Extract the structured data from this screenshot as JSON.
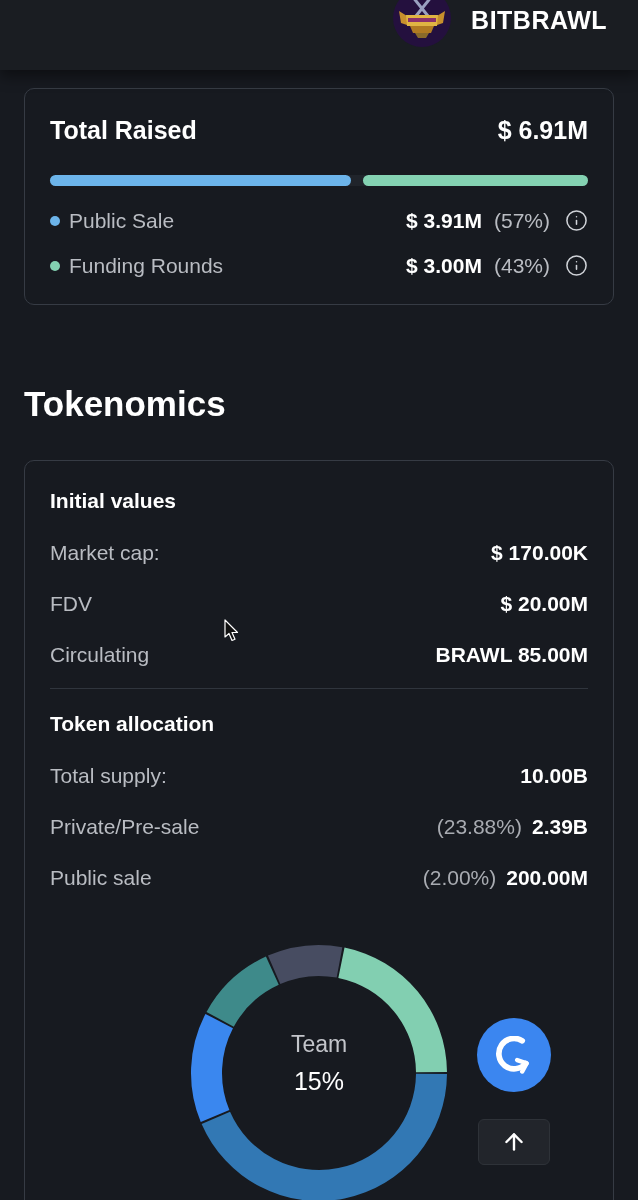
{
  "header": {
    "brand": "BITBRAWL"
  },
  "total_raised": {
    "title": "Total Raised",
    "value": "$ 6.91M",
    "segments": [
      {
        "label": "Public Sale",
        "amount": "$ 3.91M",
        "percent": "(57%)",
        "level": 0.57,
        "color": "#6cb4ea"
      },
      {
        "label": "Funding Rounds",
        "amount": "$ 3.00M",
        "percent": "(43%)",
        "level": 0.43,
        "color": "#84d2b2"
      }
    ]
  },
  "tokenomics": {
    "heading": "Tokenomics",
    "sections": [
      {
        "title": "Initial values",
        "rows": [
          {
            "label": "Market cap:",
            "value": "$ 170.00K"
          },
          {
            "label": "FDV",
            "value": "$ 20.00M"
          },
          {
            "label": "Circulating",
            "value": "BRAWL 85.00M"
          }
        ]
      },
      {
        "title": "Token allocation",
        "rows": [
          {
            "label": "Total supply:",
            "value": "10.00B"
          },
          {
            "label": "Private/Pre-sale",
            "share": "(23.88%)",
            "value": "2.39B"
          },
          {
            "label": "Public sale",
            "share": "(2.00%)",
            "value": "200.00M"
          }
        ]
      }
    ],
    "chart": {
      "label": "Team",
      "percent": "15%"
    }
  }
}
